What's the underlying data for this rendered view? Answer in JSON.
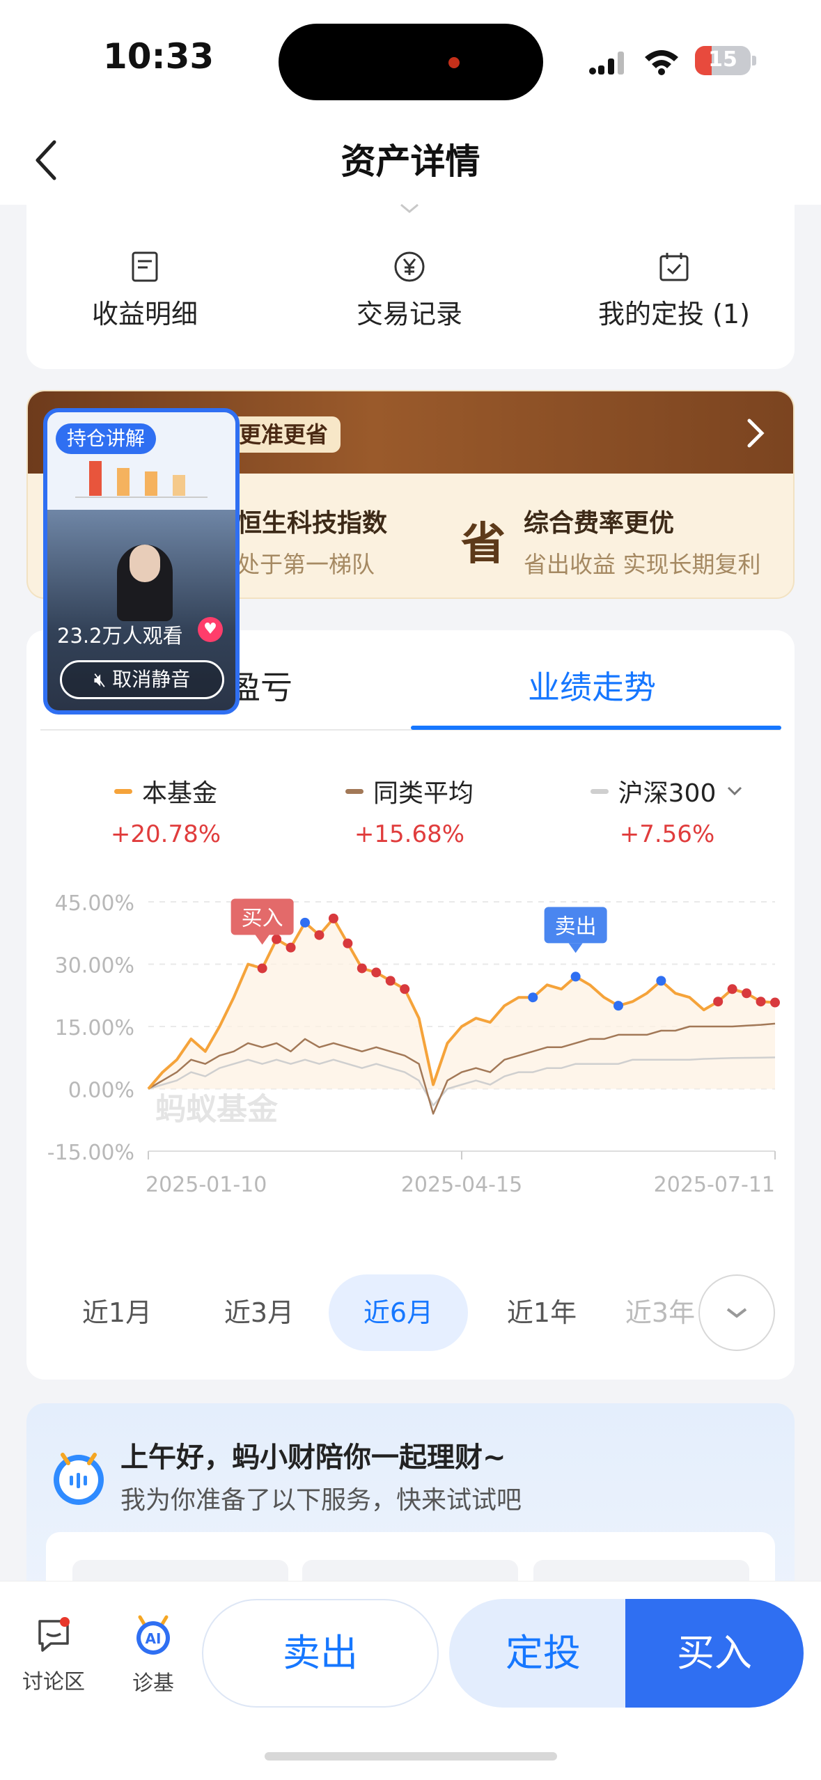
{
  "status_bar": {
    "time": "10:33",
    "battery": "15"
  },
  "nav": {
    "title": "资产详情"
  },
  "quick_menu": [
    {
      "label": "收益明细",
      "icon": "document-icon"
    },
    {
      "label": "交易记录",
      "icon": "yen-circle-icon"
    },
    {
      "label": "我的定投 (1)",
      "icon": "calendar-icon"
    }
  ],
  "promo": {
    "tag": "更准更省",
    "feature1_title": "恒生科技指数",
    "feature1_sub": "处于第一梯队",
    "feature2_icon_text": "省",
    "feature2_title": "综合费率更优",
    "feature2_sub": "省出收益 实现长期复利"
  },
  "video": {
    "tag": "持仓讲解",
    "viewers": "23.2万人观看",
    "mute_label": "取消静音"
  },
  "tabs": {
    "profit": "盈亏",
    "trend": "业绩走势"
  },
  "legend": [
    {
      "name": "本基金",
      "value": "+20.78%",
      "color": "#f5a33a"
    },
    {
      "name": "同类平均",
      "value": "+15.68%",
      "color": "#a27857"
    },
    {
      "name": "沪深300",
      "value": "+7.56%",
      "color": "#cfcfcf"
    }
  ],
  "chart_data": {
    "type": "line",
    "x": [
      "2025-01-10",
      "2025-04-15",
      "2025-07-11"
    ],
    "ylim": [
      -15,
      45
    ],
    "yticks": [
      "45.00%",
      "30.00%",
      "15.00%",
      "0.00%",
      "-15.00%"
    ],
    "watermark": "蚂蚁基金",
    "annotations": {
      "buy_label": "买入",
      "sell_label": "卖出"
    },
    "series": [
      {
        "name": "本基金",
        "color": "#f5a33a",
        "values": [
          0,
          4,
          7,
          12,
          9,
          15,
          22,
          30,
          29,
          36,
          34,
          40,
          37,
          41,
          35,
          29,
          28,
          26,
          24,
          17,
          1,
          11,
          15,
          17,
          16,
          20,
          22,
          22,
          25,
          24,
          27,
          25,
          22,
          20,
          21,
          23,
          26,
          23,
          22,
          19,
          21,
          24,
          23,
          21,
          20.78
        ]
      },
      {
        "name": "同类平均",
        "color": "#a27857",
        "values": [
          0,
          2,
          4,
          7,
          6,
          8,
          9,
          11,
          10,
          11,
          9,
          12,
          10,
          11,
          10,
          9,
          10,
          9,
          8,
          6,
          -6,
          2,
          4,
          5,
          4,
          7,
          8,
          9,
          10,
          10,
          11,
          12,
          12,
          13,
          13,
          13,
          14,
          14,
          15,
          15,
          15,
          15,
          15.2,
          15.4,
          15.68
        ]
      },
      {
        "name": "沪深300",
        "color": "#cfcfcf",
        "values": [
          0,
          1,
          2,
          4,
          3,
          5,
          6,
          7,
          6,
          7,
          6,
          7,
          6,
          7,
          6,
          5,
          6,
          5,
          4,
          2,
          -4,
          0,
          1,
          2,
          1,
          3,
          4,
          4,
          5,
          5,
          6,
          6,
          6,
          6,
          7,
          7,
          7,
          7,
          7,
          7.2,
          7.3,
          7.4,
          7.45,
          7.5,
          7.56
        ]
      }
    ],
    "buy_points": [
      8,
      9,
      10,
      12,
      13,
      14,
      15,
      16,
      17,
      18,
      40,
      41,
      42,
      43,
      44
    ],
    "sell_points": [
      11,
      27,
      30,
      33,
      36
    ]
  },
  "ranges": [
    "近1月",
    "近3月",
    "近6月",
    "近1年",
    "近3年"
  ],
  "active_range": "近6月",
  "greeting": {
    "title": "上午好，蚂小财陪你一起理财~",
    "subtitle": "我为你准备了以下服务，快来试试吧"
  },
  "bottom": {
    "discuss": "讨论区",
    "diagnose": "诊基",
    "sell": "卖出",
    "plan": "定投",
    "buy": "买入"
  }
}
